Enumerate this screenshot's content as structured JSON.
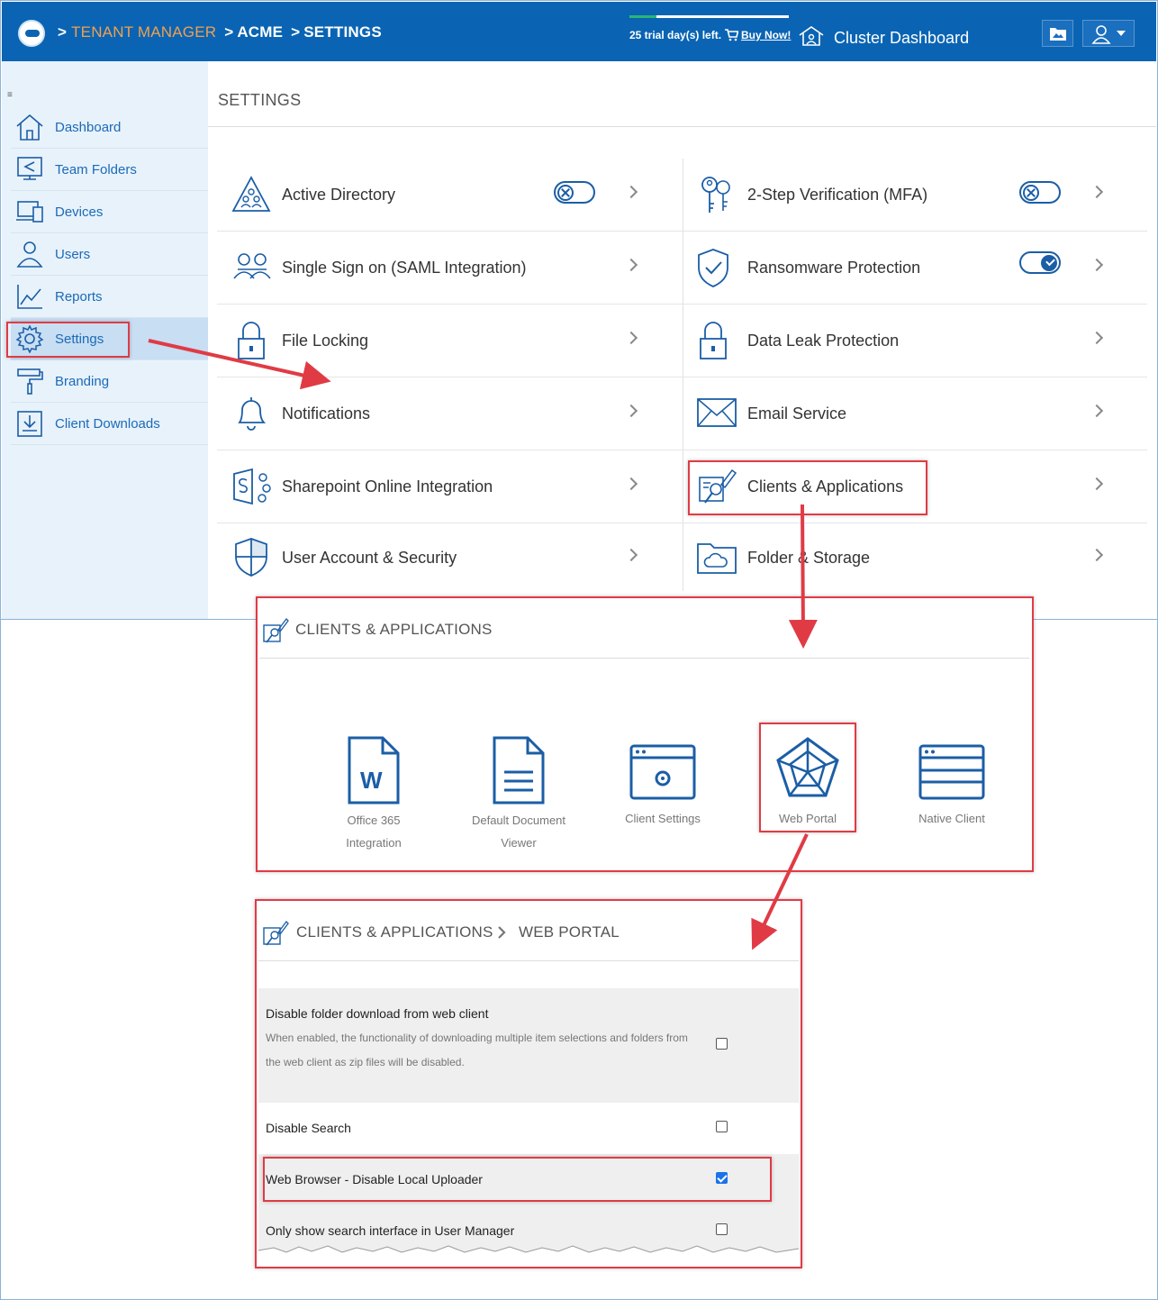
{
  "topbar": {
    "crumb_root": "TENANT MANAGER",
    "crumb_tenant": "ACME",
    "crumb_page": "SETTINGS",
    "trial_text": "25 trial day(s) left.",
    "buy_now": "Buy Now!",
    "cluster_dashboard": "Cluster Dashboard",
    "sep": ">"
  },
  "sidebar": {
    "items": [
      {
        "label": "Dashboard",
        "icon": "home-icon"
      },
      {
        "label": "Team Folders",
        "icon": "team-folders-icon"
      },
      {
        "label": "Devices",
        "icon": "devices-icon"
      },
      {
        "label": "Users",
        "icon": "users-icon"
      },
      {
        "label": "Reports",
        "icon": "reports-icon"
      },
      {
        "label": "Settings",
        "icon": "gear-icon"
      },
      {
        "label": "Branding",
        "icon": "paint-roller-icon"
      },
      {
        "label": "Client Downloads",
        "icon": "download-icon"
      }
    ],
    "active_index": 5
  },
  "settings": {
    "title": "SETTINGS",
    "left": [
      {
        "label": "Active Directory",
        "toggle": "off"
      },
      {
        "label": "Single Sign on (SAML Integration)"
      },
      {
        "label": "File Locking"
      },
      {
        "label": "Notifications"
      },
      {
        "label": "Sharepoint Online Integration"
      },
      {
        "label": "User Account & Security"
      }
    ],
    "right": [
      {
        "label": "2-Step Verification (MFA)",
        "toggle": "off"
      },
      {
        "label": "Ransomware Protection",
        "toggle": "on"
      },
      {
        "label": "Data Leak Protection"
      },
      {
        "label": "Email Service"
      },
      {
        "label": "Clients & Applications"
      },
      {
        "label": "Folder & Storage"
      }
    ]
  },
  "clients_panel": {
    "title": "CLIENTS & APPLICATIONS",
    "tiles": [
      {
        "line1": "Office 365",
        "line2": "Integration"
      },
      {
        "line1": "Default Document",
        "line2": "Viewer"
      },
      {
        "line1": "Client Settings",
        "line2": ""
      },
      {
        "line1": "Web Portal",
        "line2": ""
      },
      {
        "line1": "Native Client",
        "line2": ""
      }
    ]
  },
  "web_portal_panel": {
    "title": "CLIENTS & APPLICATIONS",
    "subtitle": "WEB PORTAL",
    "options": [
      {
        "title": "Disable folder download from web client",
        "desc": "When enabled, the functionality of downloading multiple item selections and folders from the web client as zip files will be disabled.",
        "checked": false
      },
      {
        "title": "Disable Search",
        "checked": false
      },
      {
        "title": "Web Browser - Disable Local Uploader",
        "checked": true
      },
      {
        "title": "Only show search interface in User Manager",
        "checked": false
      }
    ]
  },
  "colors": {
    "brand": "#0a64b3",
    "annotation": "#e03b45",
    "link": "#1b6ab8",
    "accent_orange": "#f0a050"
  }
}
